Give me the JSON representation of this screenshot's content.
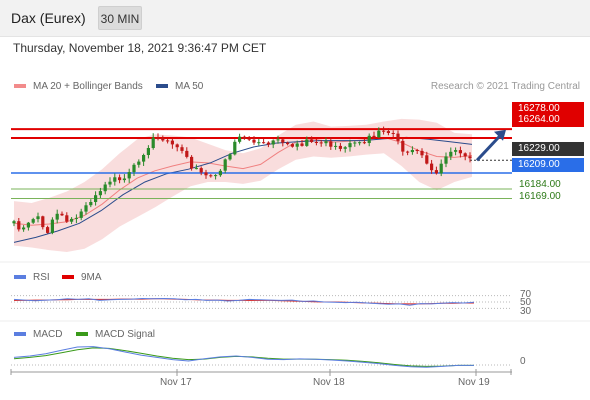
{
  "header": {
    "title": "Dax (Eurex)",
    "timeframe": "30 MIN"
  },
  "datetime": "Thursday, November 18, 2021 9:36:47 PM CET",
  "legend": {
    "ma20": "MA 20 + Bollinger Bands",
    "ma50": "MA 50",
    "credit": "Research © 2021 Trading Central"
  },
  "price_tags": {
    "r1": "16278.00",
    "r2": "16264.00",
    "last": "16229.00",
    "s0": "16209.00",
    "s1": "16184.00",
    "s2": "16169.00"
  },
  "rsi_panel": {
    "label": "RSI",
    "signal_label": "9MA",
    "levels": [
      "70",
      "50",
      "30"
    ]
  },
  "macd_panel": {
    "label": "MACD",
    "signal_label": "MACD Signal",
    "zero": "0"
  },
  "colors": {
    "red": "#e00000",
    "blue": "#2a6ee8",
    "green": "#2d7a18",
    "ma50": "#2b4c8c",
    "bb": "#f7d4d4",
    "up": "#2a8a2a",
    "down": "#c01818",
    "dark": "#333333"
  },
  "chart_data": {
    "type": "candlestick",
    "x_ticks": [
      "Nov 17",
      "Nov 18",
      "Nov 19"
    ],
    "ylim": [
      16085,
      16330
    ],
    "close_path": [
      16130,
      16120,
      16135,
      16140,
      16118,
      16150,
      16148,
      16140,
      16145,
      16155,
      16170,
      16185,
      16195,
      16205,
      16213,
      16230,
      16245,
      16260,
      16262,
      16262,
      16255,
      16240,
      16225,
      16222,
      16210,
      16215,
      16220,
      16240,
      16270,
      16265,
      16260,
      16265,
      16262,
      16270,
      16265,
      16260,
      16255,
      16262,
      16260,
      16258,
      16262,
      16255,
      16264,
      16270,
      16266,
      16268,
      16278,
      16275,
      16260,
      16250,
      16258,
      16245,
      16225,
      16210,
      16238,
      16245,
      16236,
      16229
    ],
    "bollinger": {
      "upper": [
        16165,
        16162,
        16170,
        16180,
        16195,
        16215,
        16240,
        16262,
        16270,
        16268,
        16265,
        16255,
        16245,
        16240,
        16248,
        16268,
        16285,
        16290,
        16282,
        16283,
        16285,
        16290,
        16294,
        16293,
        16288,
        16272,
        16270
      ],
      "lower": [
        16095,
        16092,
        16088,
        16085,
        16090,
        16105,
        16125,
        16140,
        16155,
        16172,
        16188,
        16195,
        16195,
        16192,
        16197,
        16215,
        16230,
        16235,
        16233,
        16235,
        16238,
        16240,
        16220,
        16195,
        16182,
        16195,
        16203
      ]
    },
    "ma50": [
      16100,
      16108,
      16118,
      16130,
      16150,
      16175,
      16195,
      16208,
      16215,
      16225,
      16240,
      16250,
      16256,
      16258,
      16260,
      16260,
      16260,
      16263,
      16265,
      16262,
      16258,
      16254
    ],
    "forecast_arrow": {
      "from": 16229,
      "to": 16277
    },
    "levels": [
      {
        "value": 16278.0,
        "kind": "resistance"
      },
      {
        "value": 16264.0,
        "kind": "resistance"
      },
      {
        "value": 16229.0,
        "kind": "last"
      },
      {
        "value": 16209.0,
        "kind": "pivot"
      },
      {
        "value": 16184.0,
        "kind": "support"
      },
      {
        "value": 16169.0,
        "kind": "support"
      }
    ],
    "rsi": {
      "ylim": [
        0,
        100
      ],
      "levels": [
        70,
        50,
        30
      ],
      "series": [
        58,
        56,
        54,
        56,
        57,
        60,
        58,
        60,
        55,
        57,
        58,
        59,
        61,
        60,
        61,
        60,
        57,
        58,
        55,
        56,
        53,
        55,
        58,
        57,
        56,
        55,
        56,
        52,
        53,
        50,
        49,
        48,
        49,
        47,
        45,
        43,
        44,
        40,
        45,
        44,
        46,
        48,
        47,
        49
      ],
      "signal": [
        55,
        55,
        56,
        56,
        57,
        57,
        58,
        58,
        58,
        58,
        59,
        59,
        59,
        60,
        60,
        59,
        58,
        57,
        56,
        56,
        55,
        55,
        55,
        55,
        55,
        54,
        53,
        52,
        51,
        50,
        50,
        49,
        48,
        47,
        46,
        45,
        44,
        44,
        44,
        45,
        46,
        46,
        47,
        47
      ]
    },
    "macd": {
      "macd": [
        0.42,
        0.5,
        0.62,
        0.82,
        1,
        1.02,
        0.9,
        0.72,
        0.55,
        0.42,
        0.3,
        0.22,
        0.35,
        0.45,
        0.5,
        0.42,
        0.32,
        0.3,
        0.34,
        0.32,
        0.28,
        0.22,
        0.15,
        0.08,
        -0.02,
        -0.1,
        -0.12,
        -0.08,
        -0.02,
        -0.02
      ],
      "signal": [
        0.35,
        0.42,
        0.52,
        0.68,
        0.85,
        0.95,
        0.92,
        0.8,
        0.65,
        0.5,
        0.38,
        0.3,
        0.33,
        0.42,
        0.48,
        0.45,
        0.38,
        0.33,
        0.33,
        0.32,
        0.3,
        0.26,
        0.2,
        0.12,
        0.03,
        -0.05,
        -0.08,
        -0.06,
        -0.02,
        -0.02
      ]
    }
  }
}
